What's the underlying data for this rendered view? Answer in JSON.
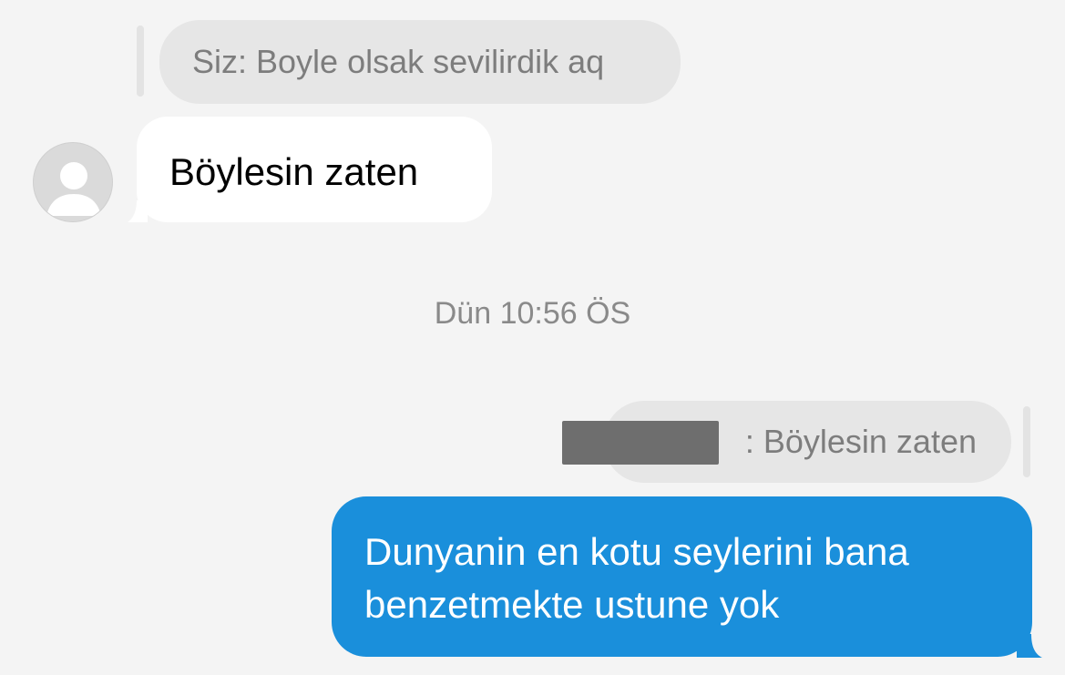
{
  "thread": {
    "reply_preview_1": {
      "text": "Siz: Boyle olsak sevilirdik aq"
    },
    "incoming_message": {
      "text": "Böylesin zaten"
    },
    "timestamp": "Dün 10:56 ÖS",
    "reply_preview_2": {
      "suffix": ": Böylesin zaten"
    },
    "outgoing_message": {
      "line1": "Dunyanin en kotu seylerini bana",
      "line2": "benzetmekte ustune yok"
    }
  },
  "colors": {
    "background": "#f4f4f4",
    "outgoing_bubble": "#1a8fdb",
    "incoming_bubble": "#ffffff",
    "reply_bubble": "#e6e6e6"
  },
  "icons": {
    "avatar": "default-user-icon"
  }
}
